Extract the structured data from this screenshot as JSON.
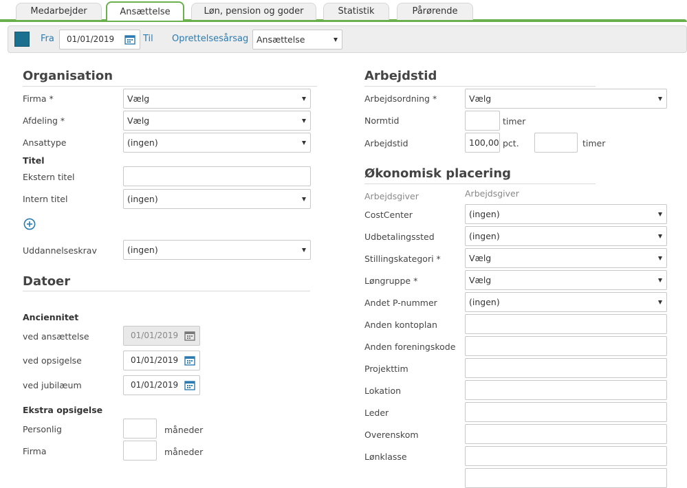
{
  "tabs": [
    {
      "label": "Medarbejder",
      "active": false
    },
    {
      "label": "Ansættelse",
      "active": true
    },
    {
      "label": "Løn, pension og goder",
      "active": false
    },
    {
      "label": "Statistik",
      "active": false
    },
    {
      "label": "Pårørende",
      "active": false
    }
  ],
  "filter": {
    "fra_label": "Fra",
    "fra_value": "01/01/2019",
    "til_label": "Til",
    "reason_label": "Oprettelsesårsag",
    "reason_value": "Ansættelse"
  },
  "organisation": {
    "title": "Organisation",
    "firma_label": "Firma *",
    "firma_value": "Vælg",
    "afdeling_label": "Afdeling *",
    "afdeling_value": "Vælg",
    "ansattype_label": "Ansattype",
    "ansattype_value": "(ingen)",
    "titel_heading": "Titel",
    "ekstern_label": "Ekstern titel",
    "ekstern_value": "",
    "intern_label": "Intern titel",
    "intern_value": "(ingen)",
    "uddannelse_label": "Uddannelseskrav",
    "uddannelse_value": "(ingen)"
  },
  "datoer": {
    "title": "Datoer",
    "anciennitet_heading": "Anciennitet",
    "ansaettelse_label": "ved ansættelse",
    "ansaettelse_value": "01/01/2019",
    "opsigelse_label": "ved opsigelse",
    "opsigelse_value": "01/01/2019",
    "jubilaeum_label": "ved jubilæum",
    "jubilaeum_value": "01/01/2019",
    "ekstra_heading": "Ekstra opsigelse",
    "personlig_label": "Personlig",
    "personlig_value": "",
    "personlig_unit": "måneder",
    "firma_label": "Firma",
    "firma_value": "",
    "firma_unit": "måneder"
  },
  "arbejdstid": {
    "title": "Arbejdstid",
    "ordning_label": "Arbejdsordning *",
    "ordning_value": "Vælg",
    "normtid_label": "Normtid",
    "normtid_value": "",
    "normtid_unit": "timer",
    "arbejdstid_label": "Arbejdstid",
    "arbejdstid_value": "100,00",
    "arbejdstid_unit": "pct.",
    "arbejdstid_hours_value": "",
    "arbejdstid_hours_unit": "timer"
  },
  "okonomisk": {
    "title": "Økonomisk placering",
    "arbejdsgiver_label": "Arbejdsgiver",
    "arbejdsgiver_value": "Arbejdsgiver",
    "costcenter_label": "CostCenter",
    "costcenter_value": "(ingen)",
    "udbetalingssted_label": "Udbetalingssted",
    "udbetalingssted_value": "(ingen)",
    "stillingskategori_label": "Stillingskategori *",
    "stillingskategori_value": "Vælg",
    "loengruppe_label": "Løngruppe *",
    "loengruppe_value": "Vælg",
    "andet_p_label": "Andet P-nummer",
    "andet_p_value": "(ingen)",
    "kontoplan_label": "Anden kontoplan",
    "foreningskode_label": "Anden foreningskode",
    "projekttim_label": "Projekttim",
    "lokation_label": "Lokation",
    "leder_label": "Leder",
    "overenskom_label": "Overenskom",
    "loenklasse_label": "Lønklasse"
  },
  "colors": {
    "accent_green": "#6ab04c",
    "link_blue": "#2b7bb0",
    "handle_blue": "#1b6f8f"
  }
}
